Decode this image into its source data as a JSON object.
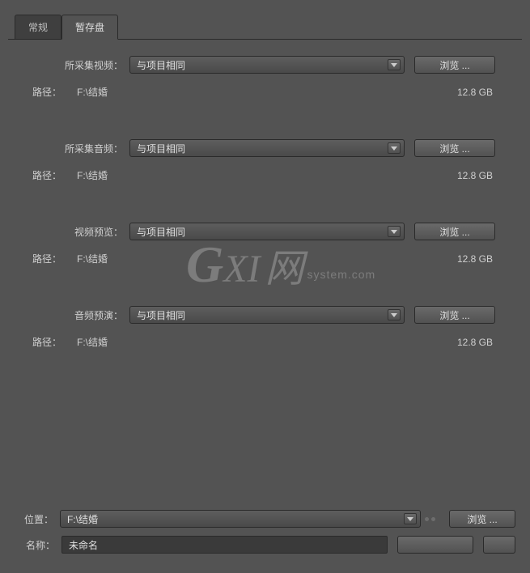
{
  "tabs": {
    "general": "常规",
    "scratch": "暂存盘"
  },
  "sections": {
    "capturedVideo": {
      "label": "所采集视频：",
      "value": "与项目相同",
      "browse": "浏览 ...",
      "pathLabel": "路径：",
      "pathValue": "F:\\结婚",
      "size": "12.8 GB"
    },
    "capturedAudio": {
      "label": "所采集音频：",
      "value": "与项目相同",
      "browse": "浏览 ...",
      "pathLabel": "路径：",
      "pathValue": "F:\\结婚",
      "size": "12.8 GB"
    },
    "videoPreview": {
      "label": "视频预览：",
      "value": "与项目相同",
      "browse": "浏览 ...",
      "pathLabel": "路径：",
      "pathValue": "F:\\结婚",
      "size": "12.8 GB"
    },
    "audioPreview": {
      "label": "音频预演：",
      "value": "与项目相同",
      "browse": "浏览 ...",
      "pathLabel": "路径：",
      "pathValue": "F:\\结婚",
      "size": "12.8 GB"
    }
  },
  "bottom": {
    "locationLabel": "位置：",
    "locationValue": "F:\\结婚",
    "locationBrowse": "浏览 ...",
    "nameLabel": "名称：",
    "nameValue": "未命名"
  },
  "watermark": {
    "g": "G",
    "xi": "XI",
    "net": "网",
    "sub": "system.com"
  }
}
